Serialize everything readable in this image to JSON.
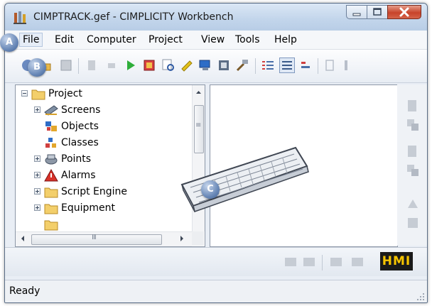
{
  "window": {
    "title": "CIMPTRACK.gef - CIMPLICITY Workbench"
  },
  "menu": {
    "items": [
      "File",
      "Edit",
      "Computer",
      "Project",
      "View",
      "Tools",
      "Help"
    ]
  },
  "callouts": {
    "a": "A",
    "b": "B",
    "c": "C"
  },
  "tree": {
    "root": "Project",
    "items": [
      "Screens",
      "Objects",
      "Classes",
      "Points",
      "Alarms",
      "Script Engine",
      "Equipment"
    ]
  },
  "scrollbar": {
    "h_grip": "III",
    "v_grip": "≡"
  },
  "lower": {
    "logo": "HMI"
  },
  "status": {
    "text": "Ready"
  },
  "colors": {
    "accent": "#3f5f91",
    "hmi_text": "#f5c400",
    "hmi_bg": "#1a1a1a"
  },
  "icons": {
    "window": "cimplicity-app-icon",
    "folder": "folder-icon",
    "keyboard": "keyboard-illustration"
  }
}
